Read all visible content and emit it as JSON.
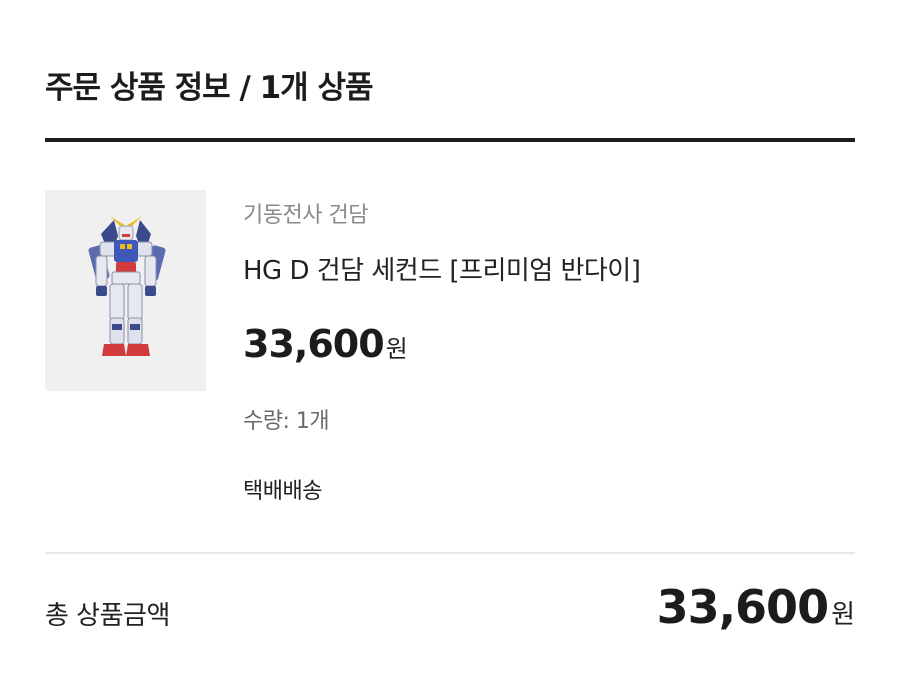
{
  "section": {
    "title": "주문 상품 정보 / 1개 상품"
  },
  "product": {
    "image_icon": "gundam-model-figure",
    "brand": "기동전사 건담",
    "name": "HG D 건담 세컨드 [프리미엄 반다이]",
    "price": "33,600",
    "price_unit": "원",
    "quantity": "수량: 1개",
    "shipping": "택배배송"
  },
  "summary": {
    "total_label": "총 상품금액",
    "total_value": "33,600",
    "total_unit": "원"
  },
  "colors": {
    "title_rule": "#1f1f1f",
    "divider": "#e8e8e8",
    "thumb_background": "#f0f0f0",
    "muted_text": "#8a8a8a"
  }
}
